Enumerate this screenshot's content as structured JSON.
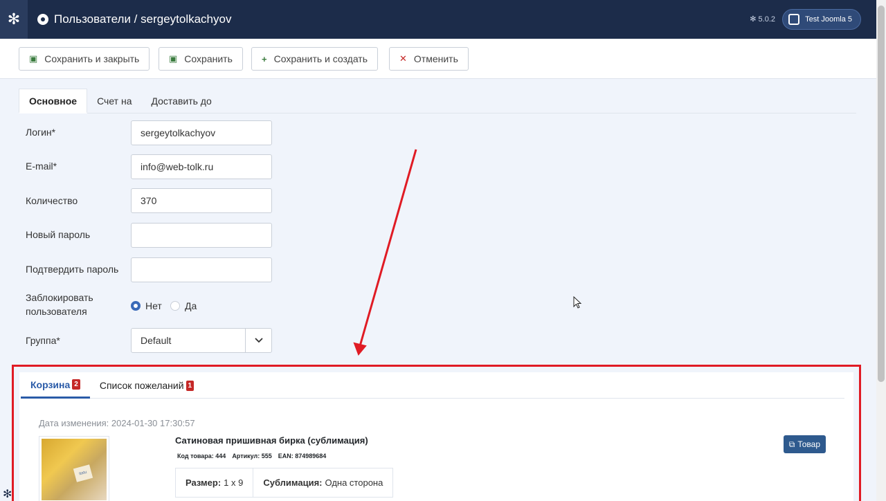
{
  "header": {
    "title": "Пользователи / sergeytolkachyov",
    "version": "5.0.2",
    "site_button": "Test Joomla 5"
  },
  "toolbar": {
    "save_close": "Сохранить и закрыть",
    "save": "Сохранить",
    "save_new": "Сохранить и создать",
    "cancel": "Отменить"
  },
  "tabs": [
    "Основное",
    "Счет на",
    "Доставить до"
  ],
  "form": {
    "login_label": "Логин*",
    "login_value": "sergeytolkachyov",
    "email_label": "E-mail*",
    "email_value": "info@web-tolk.ru",
    "quantity_label": "Количество",
    "quantity_value": "370",
    "new_password_label": "Новый пароль",
    "confirm_password_label": "Подтвердить пароль",
    "block_label_1": "Заблокировать",
    "block_label_2": "пользователя",
    "block_no": "Нет",
    "block_yes": "Да",
    "group_label": "Группа*",
    "group_value": "Default"
  },
  "panel": {
    "cart_tab": "Корзина",
    "cart_count": "2",
    "wishlist_tab": "Список пожеланий",
    "wishlist_count": "1",
    "date_changed": "Дата изменения: 2024-01-30 17:30:57",
    "product": {
      "name": "Сатиновая пришивная бирка (сублимация)",
      "code": "Код товара: 444",
      "sku": "Артикул: 555",
      "ean": "EAN: 874989684",
      "attr1_label": "Размер:",
      "attr1_value": "1 х 9",
      "attr2_label": "Сублимация:",
      "attr2_value": "Одна сторона",
      "button": "Товар",
      "thumb_tag": "itatu"
    }
  },
  "colors": {
    "header_bg": "#1c2c4a",
    "accent": "#2a5ba8",
    "annotation_red": "#e01b24"
  }
}
